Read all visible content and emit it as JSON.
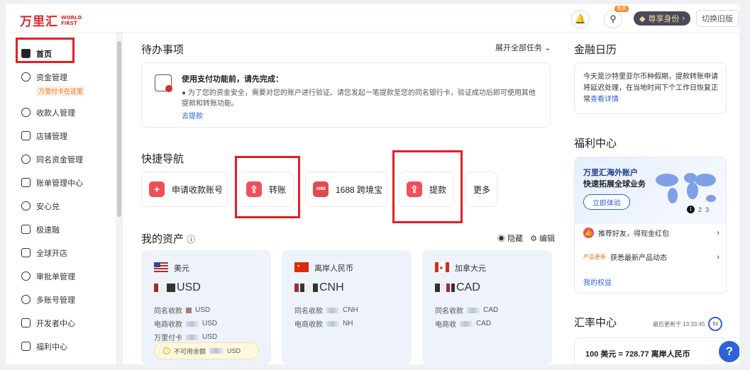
{
  "header": {
    "logo_cn": "万里汇",
    "logo_en_1": "WORLD",
    "logo_en_2": "FIRST",
    "badge": "有奖",
    "vip_label": "尊享身份",
    "switch_label": "切换旧版"
  },
  "sidebar": {
    "items": [
      {
        "label": "首页",
        "icon": "home-icon"
      },
      {
        "label": "资金管理",
        "icon": "fund-icon",
        "sub": "万里付卡在这里"
      },
      {
        "label": "收款人管理",
        "icon": "payee-icon"
      },
      {
        "label": "店铺管理",
        "icon": "store-icon"
      },
      {
        "label": "同名资金管理",
        "icon": "same-name-fund-icon"
      },
      {
        "label": "账单管理中心",
        "icon": "bill-icon"
      },
      {
        "label": "安心兑",
        "icon": "exchange-icon"
      },
      {
        "label": "极速融",
        "icon": "finance-icon"
      },
      {
        "label": "全球开店",
        "icon": "global-store-icon"
      },
      {
        "label": "审批单管理",
        "icon": "approval-icon"
      },
      {
        "label": "多账号管理",
        "icon": "multi-account-icon"
      },
      {
        "label": "开发者中心",
        "icon": "developer-icon"
      },
      {
        "label": "福利中心",
        "icon": "gift-icon"
      }
    ]
  },
  "todo": {
    "title": "待办事项",
    "expand": "展开全部任务",
    "heading": "使用支付功能前，请先完成：",
    "body": "为了您的资金安全，需要对您的账户进行验证。请您发起一笔提款至您的同名银行卡，验证成功后即可使用其他提款和转账功能。",
    "link": "去提款"
  },
  "quick_nav": {
    "title": "快捷导航",
    "items": [
      {
        "label": "申请收款账号",
        "icon": "plus-icon"
      },
      {
        "label": "转账",
        "icon": "transfer-icon"
      },
      {
        "label": "1688 跨境宝",
        "icon": "1688-icon",
        "icon_text": "1688"
      },
      {
        "label": "提款",
        "icon": "withdraw-icon"
      },
      {
        "label": "更多",
        "icon": ""
      }
    ]
  },
  "assets": {
    "title": "我的资产",
    "hide": "隐藏",
    "edit": "编辑",
    "cards": [
      {
        "currency": "美元",
        "code": "USD",
        "rows": [
          {
            "label": "同名收款",
            "unit": "USD"
          },
          {
            "label": "电商收款",
            "unit": "USD"
          },
          {
            "label": "万里付卡",
            "unit": "USD"
          }
        ],
        "warn": "不可用余额",
        "warn_unit": "USD"
      },
      {
        "currency": "离岸人民币",
        "code": "CNH",
        "rows": [
          {
            "label": "同名收款",
            "unit": "CNH"
          },
          {
            "label": "电商收款",
            "unit": "NH"
          }
        ]
      },
      {
        "currency": "加拿大元",
        "code": "CAD",
        "rows": [
          {
            "label": "同名收款",
            "unit": "CAD"
          },
          {
            "label": "电商收",
            "unit": "CAD"
          }
        ]
      }
    ]
  },
  "calendar": {
    "title": "金融日历",
    "text": "今天是沙特里亚尔币种假期，提款转账申请将延迟处理，在当地时间下个工作日恢复正常",
    "link": "查看详情"
  },
  "welfare": {
    "title": "福利中心",
    "promo_title": "万里汇海外账户",
    "promo_sub": "快速拓展全球业务",
    "promo_btn": "立即体验",
    "pages": [
      "1",
      "2",
      "3"
    ],
    "row1": "推荐好友，得现金红包",
    "row2_tag": "产品更新",
    "row2": "获悉最新产品动态",
    "link": "我的权益"
  },
  "rates": {
    "title": "汇率中心",
    "updated": "最后更新于 13:33:45",
    "countdown": "51",
    "rate": "100 美元 = 728.77 离岸人民币"
  },
  "help": "?"
}
